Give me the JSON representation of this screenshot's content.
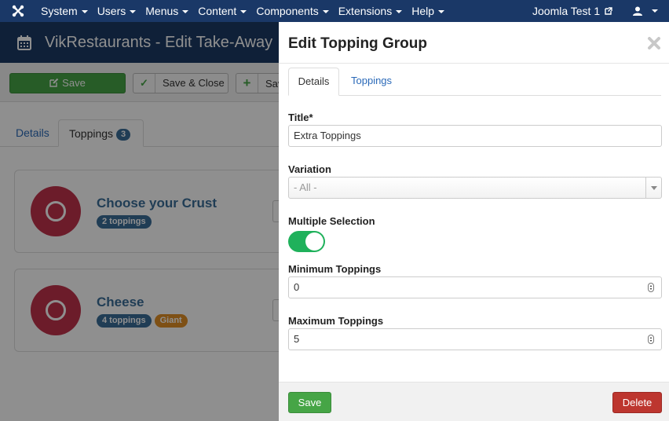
{
  "navbar": {
    "menu": [
      "System",
      "Users",
      "Menus",
      "Content",
      "Components",
      "Extensions",
      "Help"
    ],
    "site_link": "Joomla Test 1",
    "brand_color": "#1a3867"
  },
  "background": {
    "page_title": "VikRestaurants - Edit Take-Away",
    "toolbar": {
      "save": "Save",
      "save_close": "Save & Close",
      "save_new": "Sav"
    },
    "tabs": {
      "details": "Details",
      "toppings": "Toppings",
      "toppings_count": "3"
    },
    "groups": [
      {
        "title": "Choose your Crust",
        "badges": [
          {
            "text": "2 toppings",
            "color": "blue"
          }
        ]
      },
      {
        "title": "Cheese",
        "badges": [
          {
            "text": "4 toppings",
            "color": "blue"
          },
          {
            "text": "Giant",
            "color": "orange"
          }
        ]
      }
    ]
  },
  "modal": {
    "title": "Edit Topping Group",
    "tabs": {
      "details": "Details",
      "toppings": "Toppings"
    },
    "fields": {
      "title_label": "Title*",
      "title_value": "Extra Toppings",
      "variation_label": "Variation",
      "variation_value": "- All -",
      "multiple_label": "Multiple Selection",
      "multiple_on": true,
      "min_label": "Minimum Toppings",
      "min_value": "0",
      "max_label": "Maximum Toppings",
      "max_value": "5"
    },
    "footer": {
      "save": "Save",
      "delete": "Delete"
    },
    "colors": {
      "save": "#46a546",
      "delete": "#bd362f",
      "toggle_on": "#1fb15b"
    }
  }
}
